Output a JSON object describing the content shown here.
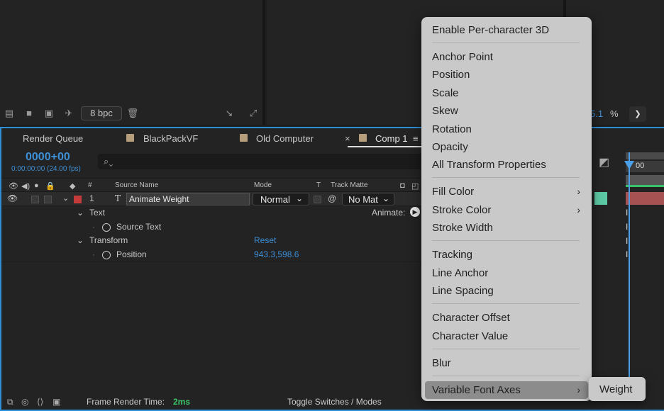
{
  "project_panel": {
    "bpc_label": "8 bpc"
  },
  "viewer": {
    "zoom_value": "5.1",
    "zoom_unit": "%"
  },
  "timeline": {
    "tabs": [
      {
        "label": "Render Queue"
      },
      {
        "label": "BlackPackVF"
      },
      {
        "label": "Old Computer"
      },
      {
        "label": "Comp 1"
      }
    ],
    "timecode": "0000+00",
    "fps_note": "0:00:00:00 (24.00 fps)",
    "columns": {
      "num": "#",
      "source_name": "Source Name",
      "mode": "Mode",
      "t": "T",
      "track_matte": "Track Matte"
    },
    "layer": {
      "index": "1",
      "name": "Animate Weight",
      "mode": "Normal",
      "matte": "No Mat"
    },
    "props": {
      "text_group": "Text",
      "animate_label": "Animate:",
      "source_text": "Source Text",
      "transform_group": "Transform",
      "reset_label": "Reset",
      "position_label": "Position",
      "position_value": "943.3,598.6"
    },
    "ruler_label": "00",
    "footer": {
      "render_time_label": "Frame Render Time:",
      "render_time_value": "2ms",
      "toggle_label": "Toggle Switches / Modes"
    }
  },
  "context_menu": {
    "items": [
      {
        "label": "Enable Per-character 3D"
      },
      {
        "label": "Anchor Point"
      },
      {
        "label": "Position"
      },
      {
        "label": "Scale"
      },
      {
        "label": "Skew"
      },
      {
        "label": "Rotation"
      },
      {
        "label": "Opacity"
      },
      {
        "label": "All Transform Properties"
      },
      {
        "label": "Fill Color"
      },
      {
        "label": "Stroke Color"
      },
      {
        "label": "Stroke Width"
      },
      {
        "label": "Tracking"
      },
      {
        "label": "Line Anchor"
      },
      {
        "label": "Line Spacing"
      },
      {
        "label": "Character Offset"
      },
      {
        "label": "Character Value"
      },
      {
        "label": "Blur"
      },
      {
        "label": "Variable Font Axes"
      }
    ],
    "submenu": {
      "label": "Weight"
    }
  },
  "colors": {
    "accent_blue": "#3d8fd6",
    "menu_bg": "#c9c9c9",
    "layer_label": "#c53b3b"
  }
}
